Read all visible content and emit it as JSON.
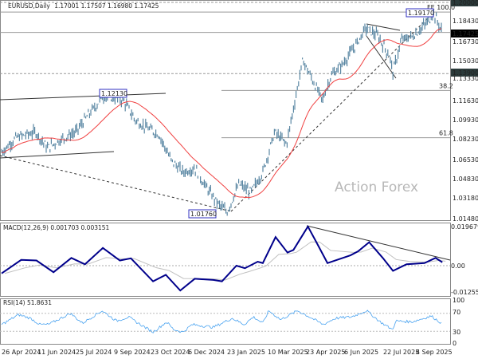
{
  "header": {
    "symbol": "EURUSD,Daily",
    "ohlc": "1.17001 1.17507 1.16980 1.17425"
  },
  "watermark": "Action Forex",
  "colors": {
    "price": "#5a87a3",
    "ma": "#f04040",
    "macd": "#00008b",
    "signal": "#c0c0c0",
    "rsi": "#4aa3f0",
    "trend": "#333333",
    "label_box": "#3030c0"
  },
  "chart_data": [
    {
      "type": "line",
      "name_label": "EURUSD,Daily",
      "ylim": [
        1.0148,
        1.2
      ],
      "y_ticks": [
        "1.20000",
        "1.18430",
        "1.17425",
        "1.16730",
        "1.15030",
        "1.13900",
        "1.13330",
        "1.11630",
        "1.09930",
        "1.08230",
        "1.06530",
        "1.04830",
        "1.03180",
        "1.01480"
      ],
      "highlighted_ticks": [
        "1.20000",
        "1.17425",
        "1.13900"
      ],
      "x": [
        "2024-04-26",
        "2024-05-13",
        "2024-06-05",
        "2024-06-19",
        "2024-07-03",
        "2024-07-22",
        "2024-08-05",
        "2024-08-24",
        "2024-09-16",
        "2024-09-30",
        "2024-10-14",
        "2024-10-28",
        "2024-11-11",
        "2024-11-25",
        "2024-12-09",
        "2024-12-23",
        "2025-01-06",
        "2025-01-16",
        "2025-01-30",
        "2025-02-13",
        "2025-02-27",
        "2025-03-13",
        "2025-03-27",
        "2025-04-05",
        "2025-04-15",
        "2025-04-24",
        "2025-05-08",
        "2025-05-18",
        "2025-06-01",
        "2025-06-14",
        "2025-06-28",
        "2025-07-12",
        "2025-07-26",
        "2025-07-30",
        "2025-08-09",
        "2025-08-23",
        "2025-09-11",
        "2025-09-15",
        "2025-09-26"
      ],
      "close": [
        1.0717,
        1.0841,
        1.0889,
        1.0752,
        1.082,
        1.0889,
        1.1026,
        1.1197,
        1.1163,
        1.0992,
        1.0923,
        1.0868,
        1.0649,
        1.0546,
        1.058,
        1.0409,
        1.0271,
        1.0203,
        1.0443,
        1.0374,
        1.0546,
        1.0889,
        1.0786,
        1.1129,
        1.1506,
        1.1369,
        1.1163,
        1.1369,
        1.1472,
        1.1609,
        1.178,
        1.1712,
        1.154,
        1.1403,
        1.1678,
        1.1712,
        1.1849,
        1.1918,
        1.17425
      ],
      "levels": [
        {
          "price": 1.2,
          "style": "dashed"
        },
        {
          "price": 1.1917,
          "label": "FE 100.0",
          "style": "solid"
        },
        {
          "price": 1.17425,
          "style": "solid"
        },
        {
          "price": 1.139,
          "style": "dashed"
        },
        {
          "price": 1.1246,
          "label": "38.2",
          "style": "solid"
        },
        {
          "price": 1.0841,
          "label": "61.8",
          "style": "solid"
        }
      ],
      "price_labels": [
        "1.19170",
        "1.12130",
        "1.01760"
      ]
    },
    {
      "type": "line",
      "title": "MACD(12,26,9) 0.001703 0.003151",
      "y_ticks": [
        "0.019679",
        "0.00",
        "-0.012552"
      ],
      "ylim": [
        -0.012552,
        0.019679
      ],
      "x": [
        "2024-04-26",
        "2024-05-19",
        "2024-06-06",
        "2024-06-26",
        "2024-07-17",
        "2024-08-02",
        "2024-08-23",
        "2024-09-12",
        "2024-09-25",
        "2024-10-21",
        "2024-11-05",
        "2024-11-22",
        "2024-12-09",
        "2024-12-31",
        "2025-01-10",
        "2025-01-27",
        "2025-02-06",
        "2025-02-21",
        "2025-02-27",
        "2025-03-14",
        "2025-03-28",
        "2025-04-04",
        "2025-04-21",
        "2025-05-01",
        "2025-05-14",
        "2025-06-10",
        "2025-06-19",
        "2025-07-02",
        "2025-07-18",
        "2025-07-30",
        "2025-08-15",
        "2025-09-05",
        "2025-09-18",
        "2025-09-26"
      ],
      "macd": [
        -0.0039,
        0.0029,
        0.0026,
        -0.0033,
        0.0039,
        0.0007,
        0.0089,
        0.0026,
        0.0037,
        -0.0079,
        -0.0046,
        -0.0125,
        -0.0066,
        -0.0072,
        -0.0079,
        0.0,
        -0.0013,
        0.002,
        0.0013,
        0.0144,
        0.0066,
        0.0079,
        0.0197,
        0.0118,
        0.0013,
        0.0052,
        0.0072,
        0.0118,
        0.0039,
        -0.0026,
        0.0007,
        0.0013,
        0.0039,
        0.0017
      ]
    },
    {
      "type": "line",
      "title": "RSI(14) 51.8631",
      "y_ticks": [
        "100",
        "70",
        "30",
        "0"
      ],
      "ylim": [
        0,
        100
      ],
      "x": [
        "2024-04-26",
        "2024-05-16",
        "2024-05-30",
        "2024-06-10",
        "2024-06-20",
        "2024-07-16",
        "2024-07-30",
        "2024-08-22",
        "2024-09-08",
        "2024-09-22",
        "2024-10-01",
        "2024-10-21",
        "2024-11-06",
        "2024-11-14",
        "2024-11-25",
        "2024-12-06",
        "2024-12-31",
        "2025-01-22",
        "2025-02-05",
        "2025-02-16",
        "2025-02-27",
        "2025-03-06",
        "2025-03-20",
        "2025-04-09",
        "2025-04-21",
        "2025-05-09",
        "2025-05-23",
        "2025-06-11",
        "2025-06-29",
        "2025-07-15",
        "2025-07-29",
        "2025-08-03",
        "2025-08-21",
        "2025-09-13",
        "2025-09-25",
        "2025-09-26"
      ],
      "rsi": [
        45,
        67,
        59,
        45,
        45,
        70,
        48,
        76,
        53,
        62,
        51,
        28,
        51,
        34,
        28,
        45,
        39,
        59,
        45,
        62,
        48,
        76,
        56,
        76,
        64,
        45,
        59,
        62,
        76,
        51,
        34,
        53,
        51,
        64,
        48,
        51.86
      ]
    }
  ],
  "x_ticks": [
    "26 Apr 2024",
    "11 Jun 2024",
    "25 Jul 2024",
    "9 Sep 2024",
    "23 Oct 2024",
    "6 Dec 2024",
    "23 Jan 2025",
    "10 Mar 2025",
    "23 Apr 2025",
    "6 Jun 2025",
    "22 Jul 2025",
    "4 Sep 2025"
  ]
}
